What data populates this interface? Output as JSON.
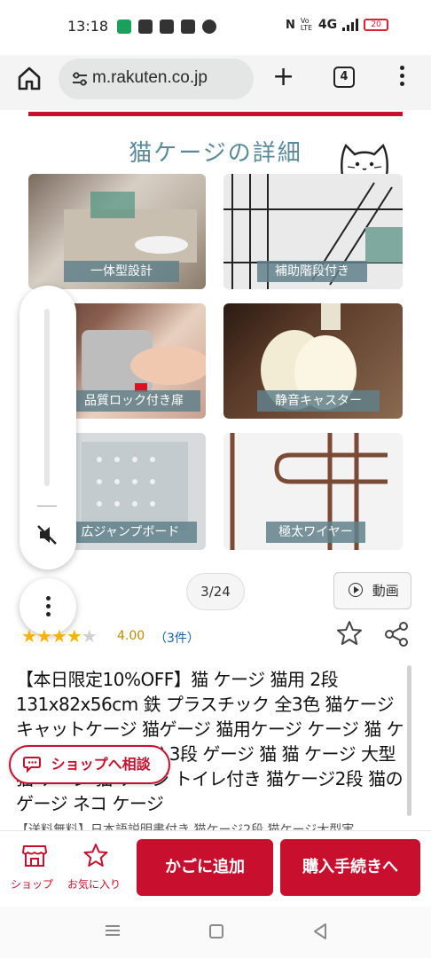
{
  "status_bar": {
    "time": "13:18",
    "network": "4G",
    "volte": "Vo LTE",
    "battery": "20"
  },
  "browser": {
    "url": "m.rakuten.co.jp",
    "tab_count": "4"
  },
  "banner": {
    "title": "猫ケージの詳細",
    "features": [
      "一体型設計",
      "補助階段付き",
      "品質ロック付き扉",
      "静音キャスター",
      "広ジャンプボード",
      "極太ワイヤー"
    ]
  },
  "gallery": {
    "counter": "3/24",
    "video_label": "動画"
  },
  "rating": {
    "value": 4.0,
    "value_text": "4.00",
    "count_text": "（3件）",
    "max": 5
  },
  "product": {
    "title": "【本日限定10%OFF】猫 ケージ 猫用 2段 131x82x56cm 鉄 プラスチック 全3色 猫ケージ キャットケージ 猫ゲージ 猫用ケージ ケージ 猫 ケージ 大型 猫ケージ 3段 ゲージ 猫 猫 ケージ 大型 猫 ケージ 猫 ケージ トイレ付き 猫ケージ2段 猫のゲージ ネコ ケージ",
    "subtitle": "【送料無料】日本語説明書付き 猫ケージ2段 猫ケージ大型実"
  },
  "consult": {
    "label": "ショップへ相談"
  },
  "actions": {
    "shop_label": "ショップ",
    "favorite_label": "お気に入り",
    "cart_label": "かごに追加",
    "buy_label": "購入手続きへ"
  },
  "colors": {
    "rakuten_red": "#c8102e",
    "banner_teal": "#5a8a99",
    "star_gold": "#f4b400"
  }
}
